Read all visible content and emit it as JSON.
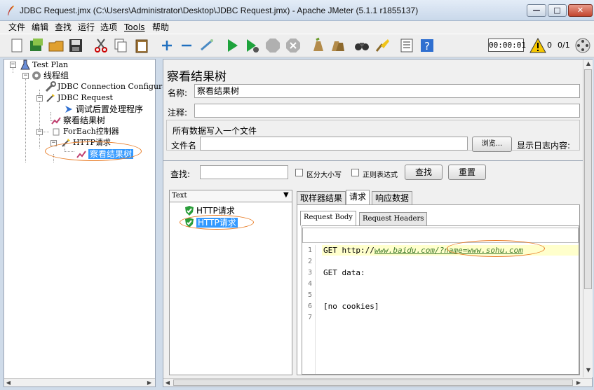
{
  "window": {
    "title": "JDBC Request.jmx (C:\\Users\\Administrator\\Desktop\\JDBC Request.jmx) - Apache JMeter (5.1.1 r1855137)",
    "controls": {
      "minimize": "▭",
      "maximize": "□",
      "close": "✕"
    }
  },
  "menu": [
    "文件",
    "编辑",
    "查找",
    "运行",
    "选项",
    "Tools",
    "帮助"
  ],
  "toolbar": {
    "icons": [
      "new-icon",
      "templates-icon",
      "open-icon",
      "save-icon",
      "cut-icon",
      "copy-icon",
      "paste-icon",
      "expand-icon",
      "collapse-icon",
      "toggle-icon",
      "start-icon",
      "start-no-pause-icon",
      "stop-icon",
      "shutdown-icon",
      "clear-icon",
      "clear-all-icon",
      "search-icon",
      "reset-search-icon",
      "function-helper-icon",
      "help-icon"
    ],
    "timer": "00:00:01",
    "warning_count": "0",
    "threads": "0/1"
  },
  "tree": {
    "nodes": [
      {
        "label": "Test Plan"
      },
      {
        "label": "线程组"
      },
      {
        "label": "JDBC Connection Configuration"
      },
      {
        "label": "JDBC Request"
      },
      {
        "label": "调试后置处理程序"
      },
      {
        "label": "察看结果树"
      },
      {
        "label": "ForEach控制器"
      },
      {
        "label": "HTTP请求"
      },
      {
        "label": "察看结果树"
      }
    ]
  },
  "panel": {
    "heading": "察看结果树",
    "name_label": "名称:",
    "name_value": "察看结果树",
    "comment_label": "注释:",
    "comment_value": "",
    "file_section": "所有数据写入一个文件",
    "filename_label": "文件名",
    "filename_value": "",
    "browse_label": "浏览...",
    "log_label": "显示日志内容:",
    "search_label": "查找:",
    "search_value": "",
    "case_label": "区分大小写",
    "regex_label": "正则表达式",
    "find_button": "查找",
    "reset_button": "重置"
  },
  "results": {
    "renderer": "Text",
    "items": [
      "HTTP请求",
      "HTTP请求"
    ],
    "tabs": [
      "取样器结果",
      "请求",
      "响应数据"
    ],
    "subtabs": [
      "Request Body",
      "Request Headers"
    ],
    "lines": [
      {
        "n": "1",
        "prefix": "GET http://",
        "link": "www.baidu.com/?name=www.sohu.com"
      },
      {
        "n": "2",
        "text": ""
      },
      {
        "n": "3",
        "text": "GET data:"
      },
      {
        "n": "4",
        "text": ""
      },
      {
        "n": "5",
        "text": ""
      },
      {
        "n": "6",
        "text": "[no cookies]"
      },
      {
        "n": "7",
        "text": ""
      }
    ]
  },
  "colors": {
    "selection": "#3399ff",
    "annotation": "#e87b24",
    "line_highlight": "#ffffcc"
  }
}
